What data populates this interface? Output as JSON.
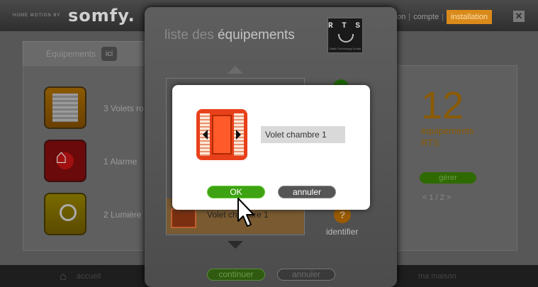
{
  "header": {
    "tagline": "HOME MOTION BY",
    "brand": "somfy.",
    "nav_items": [
      "on",
      "compte"
    ],
    "install_label": "installation",
    "close_glyph": "✕"
  },
  "tabs": {
    "equipment_label": "Équipements",
    "equipment_badge": "ici"
  },
  "equipment_groups": [
    {
      "label": "3 Volets ro",
      "icon": "blinds-icon"
    },
    {
      "label": "1 Alarme",
      "icon": "alarm-icon"
    },
    {
      "label": "2 Lumière",
      "icon": "light-icon"
    }
  ],
  "summary": {
    "count": "12",
    "count_line1": "équipements",
    "count_line2": "RTS",
    "manage_label": "gérer",
    "pager": "<  1 / 2  >"
  },
  "bottom": {
    "home_label": "accueil",
    "right_label": "ma maison"
  },
  "modal": {
    "title_light": "liste des ",
    "title_bold": "équipements",
    "rts_logo_text": "R T S",
    "rts_small": "Radio Technology Somfy",
    "selected_item": "Volet chambre 1",
    "identify_label": "identifier",
    "identify_glyph": "?",
    "continue_label": "continuer",
    "cancel_label": "annuler"
  },
  "dialog": {
    "name_value": "Volet chambre 1",
    "ok_label": "OK",
    "cancel_label": "annuler"
  },
  "colors": {
    "ok_green": "#3ea312",
    "accent_orange": "#d98a1a",
    "shutter_red": "#e8401a"
  }
}
